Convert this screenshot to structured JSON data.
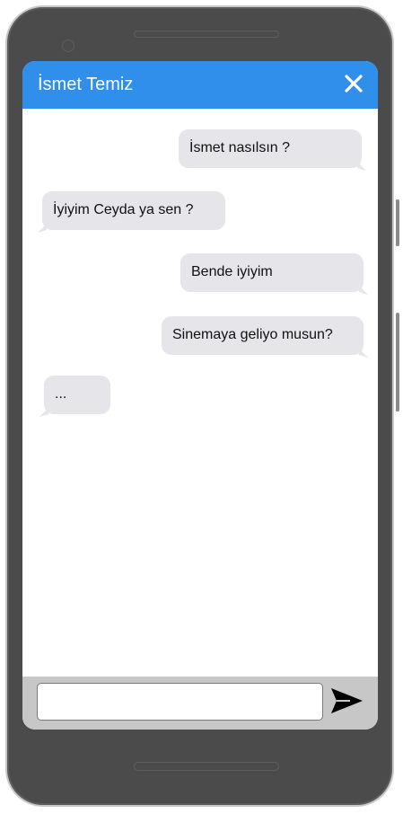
{
  "chat": {
    "title": "İsmet Temiz"
  },
  "messages": [
    {
      "direction": "outgoing",
      "text": "İsmet nasılsın ?"
    },
    {
      "direction": "incoming",
      "text": "İyiyim Ceyda ya sen ?"
    },
    {
      "direction": "outgoing",
      "text": "Bende iyiyim"
    },
    {
      "direction": "outgoing",
      "text": "Sinemaya geliyo musun?"
    },
    {
      "direction": "incoming",
      "text": "..."
    }
  ],
  "composer": {
    "value": "",
    "placeholder": ""
  },
  "icons": {
    "close": "close-icon",
    "send": "send-icon"
  },
  "colors": {
    "header": "#2f8fea",
    "bubble": "#e5e5ea",
    "device_frame": "#4b4b4b",
    "input_bar": "#c7c7c7"
  }
}
